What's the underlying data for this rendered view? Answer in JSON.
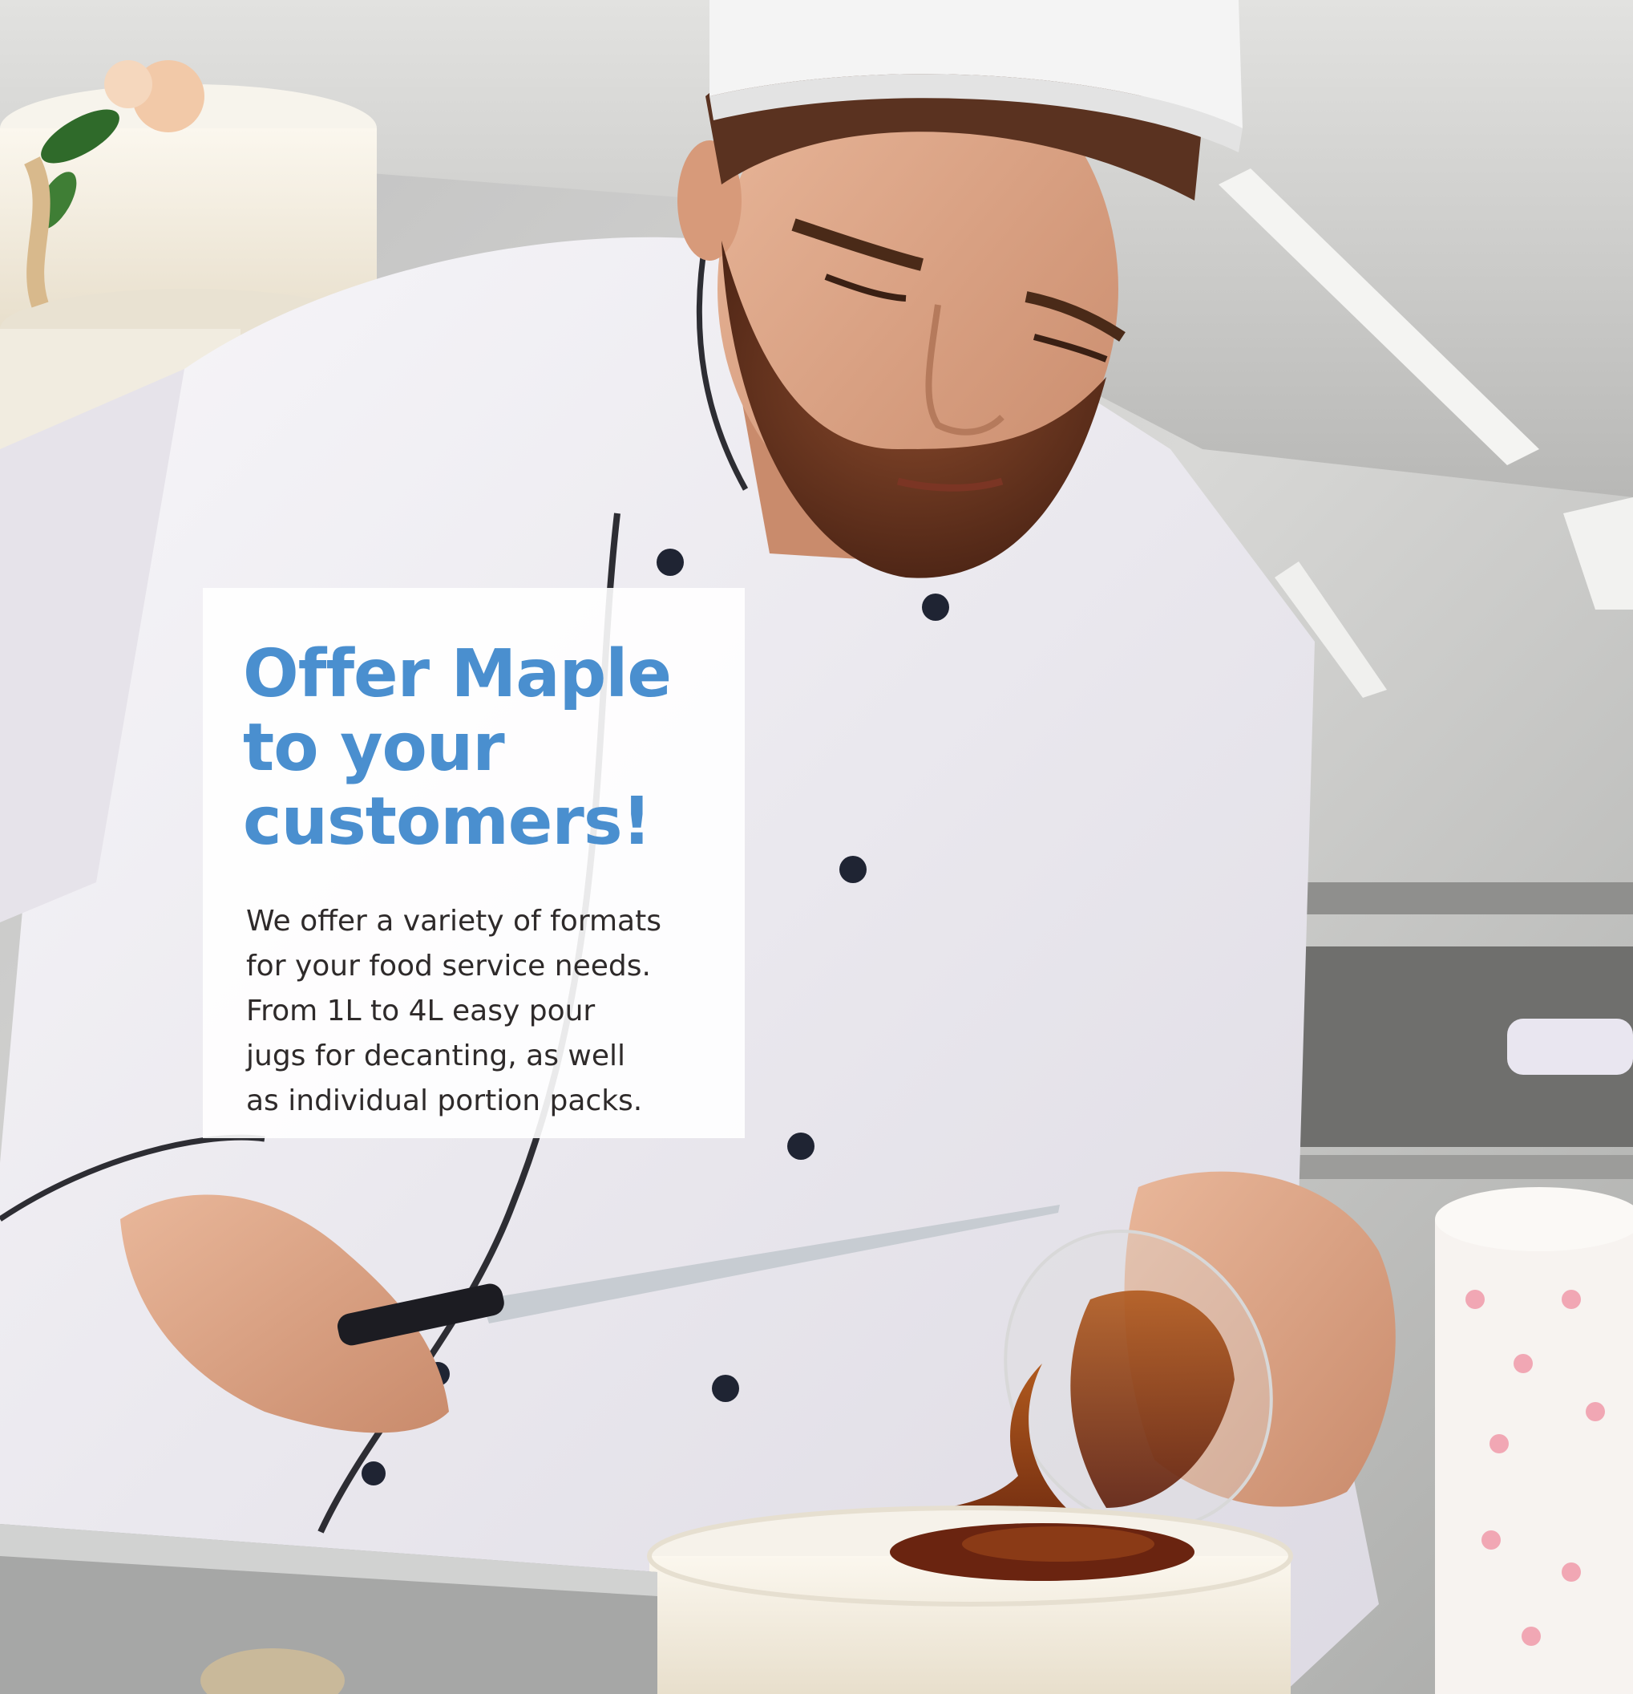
{
  "image": {
    "description": "photo-background",
    "colors": {
      "headline": "#4a8fcf",
      "body_text": "#2e2a2a",
      "panel": "#ffffff",
      "syrup": "#7a2e10"
    }
  },
  "panel": {
    "headline_lines": [
      "Offer Maple",
      "to your",
      "customers!"
    ],
    "body_lines": [
      "We offer a variety of formats",
      "for your food service needs.",
      "From 1L to 4L easy pour",
      "jugs for decanting, as well",
      "as individual portion packs."
    ]
  }
}
